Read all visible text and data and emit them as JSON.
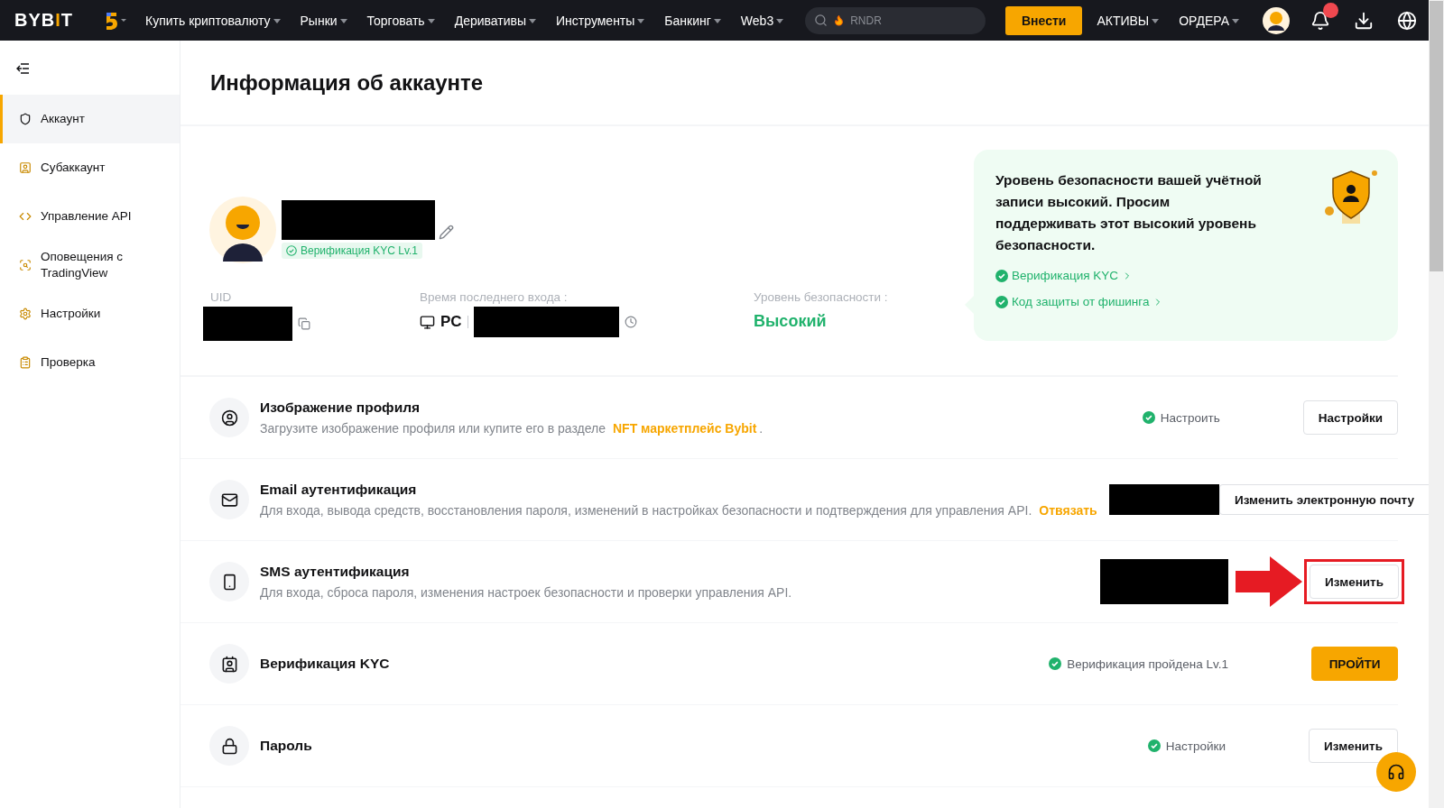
{
  "topbar": {
    "logo": "BYBIT",
    "menu": [
      {
        "label": "Купить криптовалюту"
      },
      {
        "label": "Рынки"
      },
      {
        "label": "Торговать"
      },
      {
        "label": "Деривативы"
      },
      {
        "label": "Инструменты"
      },
      {
        "label": "Банкинг"
      },
      {
        "label": "Web3"
      }
    ],
    "search": {
      "placeholder": "RNDR"
    },
    "deposit": "Внести",
    "right_menu": [
      {
        "label": "АКТИВЫ"
      },
      {
        "label": "ОРДЕРА"
      }
    ]
  },
  "sidebar": {
    "items": [
      {
        "label": "Аккаунт",
        "selected": true
      },
      {
        "label": "Субаккаунт",
        "selected": false
      },
      {
        "label": "Управление API",
        "selected": false
      },
      {
        "label": "Оповещения с TradingView",
        "selected": false
      },
      {
        "label": "Настройки",
        "selected": false
      },
      {
        "label": "Проверка",
        "selected": false
      }
    ]
  },
  "page_title": "Информация об аккаунте",
  "profile": {
    "name_redacted": true,
    "kyc_badge": "Верификация KYC Lv.1"
  },
  "info": {
    "uid_label": "UID",
    "uid_redacted": true,
    "login_label": "Время последнего входа :",
    "device": "PC",
    "login_time_redacted": true,
    "security_label": "Уровень безопасности :",
    "security_value": "Высокий"
  },
  "security_card": {
    "text": "Уровень безопасности вашей учётной записи высокий. Просим поддерживать этот высокий уровень безопасности.",
    "links": [
      "Верификация KYC",
      "Код защиты от фишинга"
    ]
  },
  "rows": [
    {
      "kind": "profile",
      "title": "Изображение профиля",
      "desc": "Загрузите изображение профиля или купите его в разделе",
      "link": "NFT маркетплейс Bybit",
      "desc_end": ".",
      "status": "Настроить",
      "redacted": false,
      "highlighted": false,
      "button": "Настройки"
    },
    {
      "kind": "email",
      "title": "Email аутентификация",
      "desc": "Для входа, вывода средств, восстановления пароля, изменений в настройках безопасности и подтверждения для управления API.",
      "link": "Отвязать",
      "redacted": true,
      "highlighted": false,
      "button": "Изменить электронную почту"
    },
    {
      "kind": "sms",
      "title": "SMS аутентификация",
      "desc": "Для входа, сброса пароля, изменения настроек безопасности и проверки управления API.",
      "redacted": true,
      "highlighted": true,
      "button": "Изменить"
    },
    {
      "kind": "kyc",
      "title": "Верификация KYC",
      "status": "Верификация пройдена Lv.1",
      "redacted": false,
      "highlighted": false,
      "button": "ПРОЙТИ"
    },
    {
      "kind": "password",
      "title": "Пароль",
      "status": "Настройки",
      "redacted": false,
      "highlighted": false,
      "button": "Изменить"
    }
  ]
}
